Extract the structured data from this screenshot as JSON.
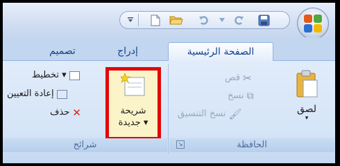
{
  "quick_access": {
    "save_icon": "save-icon",
    "undo_icon": "undo-icon",
    "redo_icon": "redo-icon",
    "open_icon": "open-folder-icon",
    "new_icon": "new-document-icon",
    "customize_icon": "customize-dropdown-icon"
  },
  "tabs": [
    {
      "label": "الصفحة الرئيسية",
      "active": true
    },
    {
      "label": "إدراج",
      "active": false
    },
    {
      "label": "تصميم",
      "active": false
    }
  ],
  "clipboard": {
    "group_label": "الحافظة",
    "paste_label": "لصق",
    "cut_label": "قص",
    "copy_label": "نسخ",
    "format_painter_label": "نسخ التنسيق"
  },
  "slides": {
    "group_label": "شرائح",
    "new_slide_line1": "شريحة",
    "new_slide_line2": "جديدة ▾",
    "layout_label": "تخطيط ▾",
    "reset_label": "إعادة التعيين",
    "delete_label": "حذف"
  },
  "colors": {
    "highlight_border": "#e2070a",
    "tab_text": "#15428b",
    "disabled_text": "#9aa8bb"
  }
}
